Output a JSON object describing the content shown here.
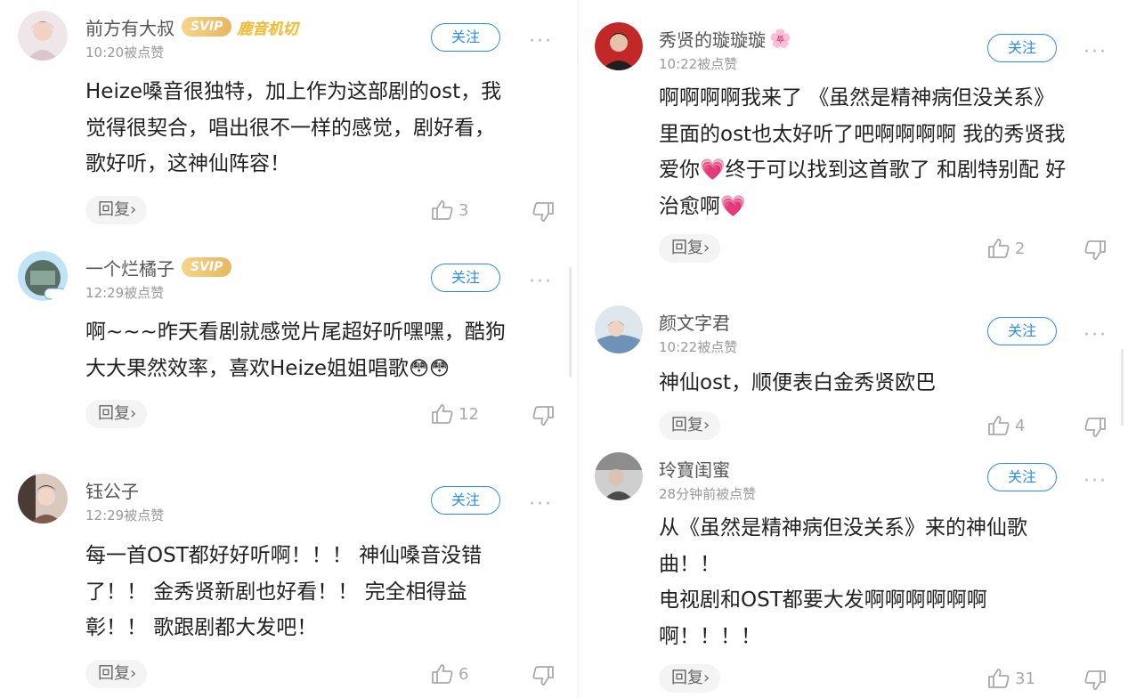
{
  "follow_label": "关注",
  "reply_label": "回复",
  "reply_chevron": "›",
  "more_label": "···",
  "left_comments": [
    {
      "name": "前方有大叔",
      "badge": "SVIP",
      "badge_extra": "鹿音机切",
      "time": "10:20被点赞",
      "lines": [
        "Heize嗓音很独特，加上作为这部剧的ost，我",
        "觉得很契合，唱出很不一样的感觉，剧好看，",
        "歌好听，这神仙阵容！"
      ],
      "likes": "3"
    },
    {
      "name": "一个烂橘子",
      "badge": "SVIP",
      "time": "12:29被点赞",
      "lines": [
        "啊~~~昨天看剧就感觉片尾超好听嘿嘿，酷狗",
        "大大果然效率，喜欢Heize姐姐唱歌"
      ],
      "emoji": "😳😳",
      "likes": "12"
    },
    {
      "name": "钰公子",
      "time": "12:29被点赞",
      "lines": [
        "每一首OST都好好听啊！！！ 神仙嗓音没错",
        "了！！ 金秀贤新剧也好看！！ 完全相得益",
        "彰！！ 歌跟剧都大发吧！"
      ],
      "likes": "6"
    }
  ],
  "right_comments": [
    {
      "name": "秀贤的璇璇璇",
      "name_emoji": "🌸",
      "time": "10:22被点赞",
      "lines": [
        "啊啊啊啊我来了 《虽然是精神病但没关系》",
        "里面的ost也太好听了吧啊啊啊啊 我的秀贤我",
        "爱你💗终于可以找到这首歌了 和剧特别配 好",
        "治愈啊💗"
      ],
      "likes": "2"
    },
    {
      "name": "颜文字君",
      "time": "10:22被点赞",
      "lines": [
        "神仙ost，顺便表白金秀贤欧巴"
      ],
      "likes": "4"
    },
    {
      "name": "玲寶闺蜜",
      "time": "28分钟前被点赞",
      "lines": [
        "从《虽然是精神病但没关系》来的神仙歌",
        "曲！！",
        "电视剧和OST都要大发啊啊啊啊啊啊",
        "啊！！！！"
      ],
      "likes": "31"
    }
  ],
  "colors": {
    "accent": "#2a8cf0",
    "svip_gold": "#e9b660",
    "muted_text": "#999999",
    "body_text": "#222222"
  },
  "icons": [
    "thumbs-up-icon",
    "thumbs-down-icon",
    "more-icon",
    "chevron-right-icon"
  ]
}
